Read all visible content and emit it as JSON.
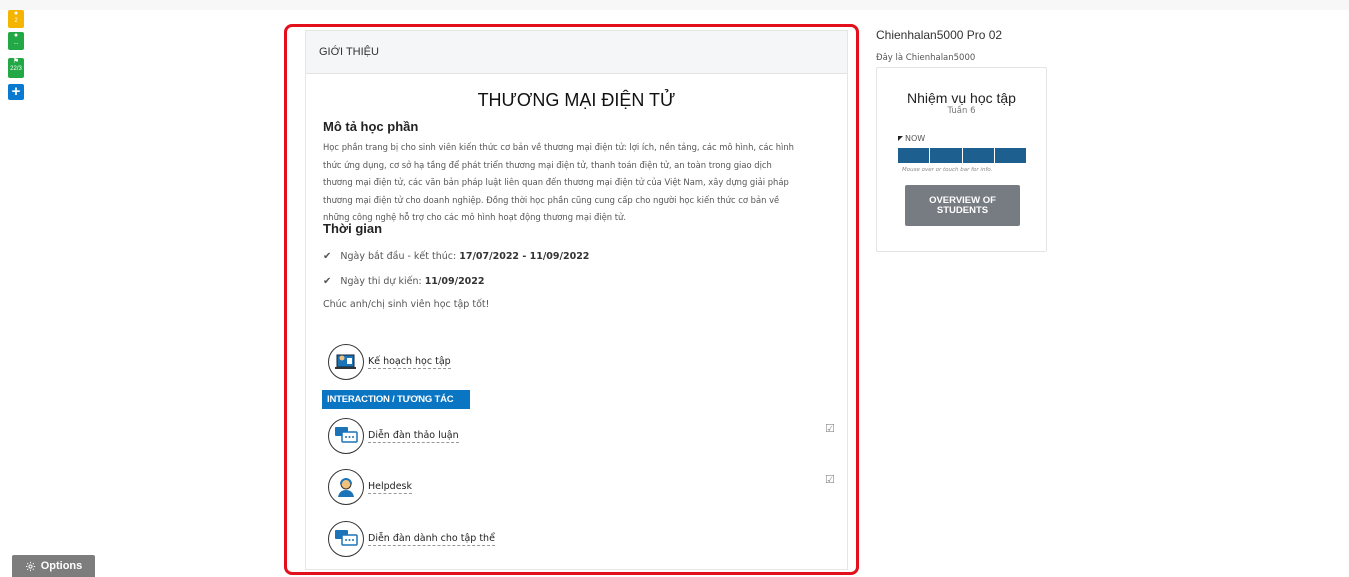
{
  "sidebar": {
    "badges": [
      {
        "icon": "bell-icon",
        "count": "2",
        "color": "#f4b400"
      },
      {
        "icon": "chat-icon",
        "count": "...",
        "color": "#22a845"
      },
      {
        "icon": "flag-icon",
        "count": "22/3",
        "color": "#22a845"
      },
      {
        "icon": "plus-icon",
        "glyph": "+",
        "color": "#0a7ad0"
      }
    ],
    "options_label": "Options"
  },
  "card": {
    "header": "GIỚI THIỆU",
    "course_title": "THƯƠNG MẠI ĐIỆN TỬ",
    "description_heading": "Mô tả học phần",
    "description_lines": [
      "Học phần trang bị cho sinh viên kiến thức cơ bản về thương mại điện tử: lợi ích, nền tảng, các mô hình, các hình",
      "thức ứng dụng, cơ sở hạ tầng để phát triển thương mại điện tử, thanh toán điện tử, an toàn trong giao dịch",
      "thương mại điện tử, các văn bản pháp luật liên quan đến thương mại điện tử của Việt Nam, xây dựng giải pháp",
      "thương mại điện tử cho doanh nghiệp. Đồng thời học phần cũng cung cấp cho người học kiến thức cơ bản về",
      "những công nghệ hỗ trợ cho các mô hình hoạt động thương mại điện tử."
    ],
    "time_heading": "Thời gian",
    "dates": [
      {
        "label": "Ngày bắt đầu - kết thúc:",
        "value": "17/07/2022 - 11/09/2022"
      },
      {
        "label": "Ngày thi dự kiến:",
        "value": "11/09/2022"
      }
    ],
    "wish": "Chúc anh/chị sinh viên học tập tốt!",
    "plan_label": "Kế hoạch học tập",
    "interaction_label": "INTERACTION / TƯƠNG TÁC",
    "activities": [
      {
        "label": "Diễn đàn thảo luận",
        "icon": "forum-icon",
        "checked": true
      },
      {
        "label": "Helpdesk",
        "icon": "helpdesk-icon",
        "checked": true
      },
      {
        "label": "Diễn đàn dành cho tập thể",
        "icon": "group-forum-icon",
        "checked": false
      }
    ],
    "check_glyph": "☑",
    "tick_glyph": "✔"
  },
  "right": {
    "user_name": "Chienhalan5000 Pro 02",
    "user_sub": "Đây là Chienhalan5000",
    "task_title": "Nhiệm vụ học tập",
    "task_week": "Tuần 6",
    "now_label": "NOW",
    "bar_hint": "Mouse over or touch bar for info.",
    "overview_line1": "OVERVIEW OF",
    "overview_line2": "STUDENTS",
    "bar_color": "#1d5f8e"
  },
  "colors": {
    "highlight_border": "#e3101c",
    "interaction_bg": "#0a75c2"
  }
}
